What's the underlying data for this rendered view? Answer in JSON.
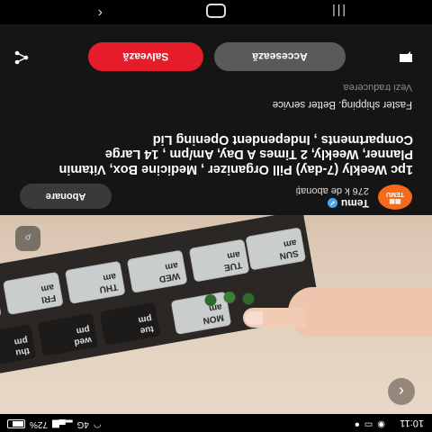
{
  "status_bar": {
    "time": "10:11",
    "battery_percent": "72%",
    "signal_text": "4G"
  },
  "photo": {
    "compartments_top": [
      "sun\npm",
      "sat\npm",
      "fri\npm",
      "thu\npm",
      "wed\npm",
      "tue\npm",
      "mon\npm"
    ],
    "compartments_bottom": [
      "SUN\nam",
      "MON\nam",
      "TUE\nam",
      "WED\nam",
      "THU\nam",
      "FRI\nam",
      "SAT\nam"
    ],
    "icons": {
      "back": "back-arrow-icon",
      "lens": "image-search-icon"
    }
  },
  "shop": {
    "name": "Temu",
    "followers": "276 k de abonați",
    "subscribe_label": "Abonare",
    "logo_text": "TEMU"
  },
  "product": {
    "title": "1pc Weekly (7-day) Pill Organizer , Medicine Box, Vitamin Planner, Weekly, 2 Times A Day, Am/pm , 14 Large Compartments , Independent Opening Lid",
    "subtitle": "Faster shipping. Better service",
    "translate_link": "Vezi traducerea"
  },
  "actions": {
    "access_label": "Accesează",
    "save_label": "Salvează"
  },
  "colors": {
    "save_button": "#e51d2a",
    "access_button": "#5a5a5a",
    "logo": "#f56a1a",
    "verified": "#4aa3f0"
  }
}
